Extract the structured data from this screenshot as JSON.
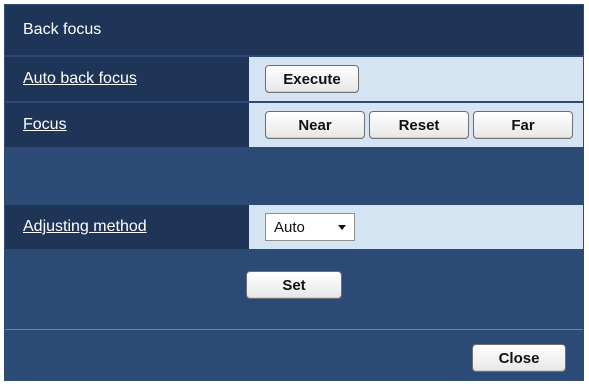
{
  "panel": {
    "title": "Back focus"
  },
  "rows": {
    "auto_back_focus": {
      "label": "Auto back focus",
      "execute_label": "Execute"
    },
    "focus": {
      "label": "Focus",
      "near_label": "Near",
      "reset_label": "Reset",
      "far_label": "Far"
    },
    "adjusting_method": {
      "label": "Adjusting method",
      "value": "Auto"
    }
  },
  "actions": {
    "set_label": "Set",
    "close_label": "Close"
  },
  "colors": {
    "header_bg": "#1f3557",
    "panel_bg": "#2b4a75",
    "control_bg": "#d5e4f3"
  },
  "icons": {
    "dropdown_caret": "chevron-down-icon"
  }
}
